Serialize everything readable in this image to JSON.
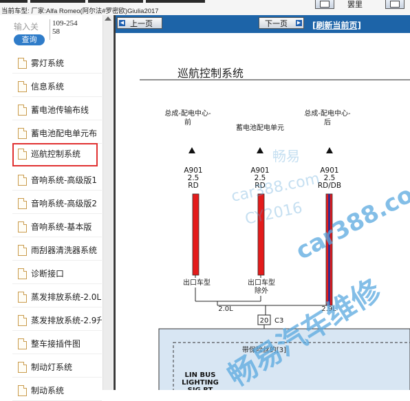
{
  "top": {
    "car_info": "当前车型: 厂家:Alfa Romeo(阿尔法#罗密欧)Giulia2017",
    "right_label": "罢里"
  },
  "sidebar": {
    "search_label": "输入关",
    "search_value": "109-25458",
    "search_button": "查询",
    "items": [
      {
        "label": "雾灯系统"
      },
      {
        "label": "信息系统"
      },
      {
        "label": "蓄电池传输布线"
      },
      {
        "label": "蓄电池配电单元布"
      },
      {
        "label": "巡航控制系统",
        "selected": true
      },
      {
        "label": "音响系统-高级版1"
      },
      {
        "label": "音响系统-高级版2"
      },
      {
        "label": "音响系统-基本版"
      },
      {
        "label": "雨刮器清洗器系统"
      },
      {
        "label": "诊断接口"
      },
      {
        "label": "蒸发排放系统-2.0L"
      },
      {
        "label": "蒸发排放系统-2.9升"
      },
      {
        "label": "整车接插件图"
      },
      {
        "label": "制动灯系统"
      },
      {
        "label": "制动系统"
      }
    ]
  },
  "nav": {
    "prev_label": "上一页",
    "next_label": "下一页",
    "refresh_label": "[刷新当前页]"
  },
  "diagram": {
    "title": "巡航控制系统",
    "col1_header": "总成-配电中心-\n前",
    "col2_header": "蓄电池配电单元",
    "col3_header": "总成-配电中心-\n后",
    "col1_wire": [
      "A901",
      "2.5",
      "RD"
    ],
    "col2_wire": [
      "A901",
      "2.5",
      "RD"
    ],
    "col3_wire": [
      "A901",
      "2.5",
      "RD/DB"
    ],
    "label_left": "出口车型",
    "label_mid": "出口车型\n除外",
    "label_20l": "2.0L",
    "label_29l": "2.9L",
    "connector_pin": "20",
    "connector_name": "C3",
    "fuse_label": "带保险丝的[3]",
    "lin_label": "LIN BUS\nLIGHTING\nSIG RT",
    "watermark_text": [
      "畅易",
      "car388.com",
      "CY2016",
      "car388.com",
      "畅易汽车维修"
    ],
    "colors": {
      "wire_red": "#e31b1b",
      "wire_db": "#3a2a8a",
      "box_fill": "#d8e6f3"
    }
  }
}
